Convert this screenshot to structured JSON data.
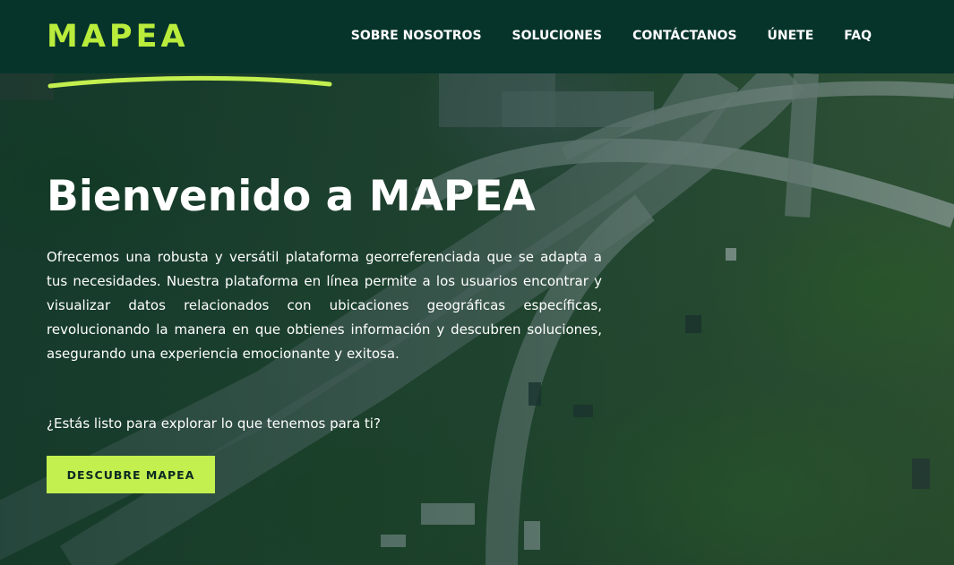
{
  "header": {
    "logo_text": "MAPEA",
    "nav": [
      {
        "label": "SOBRE NOSOTROS"
      },
      {
        "label": "SOLUCIONES"
      },
      {
        "label": "CONTÁCTANOS"
      },
      {
        "label": "ÚNETE"
      },
      {
        "label": "FAQ"
      }
    ]
  },
  "hero": {
    "title": "Bienvenido a MAPEA",
    "description": "Ofrecemos una robusta y versátil plataforma georreferenciada que se adapta a tus necesidades. Nuestra plataforma en línea permite a los usuarios encontrar y visualizar datos relacionados con ubicaciones geográficas específicas, revolucionando la manera en que obtienes información y descubren soluciones, asegurando una experiencia emocionante y exitosa.",
    "question": "¿Estás listo para explorar lo que tenemos para ti?",
    "cta_label": "DESCUBRE MAPEA",
    "background_image": "aerial-highway-interchange-photo"
  },
  "colors": {
    "header_bg": "#06342b",
    "accent": "#c3ef4f",
    "logo": "#b9ec3b",
    "text": "#ffffff"
  }
}
